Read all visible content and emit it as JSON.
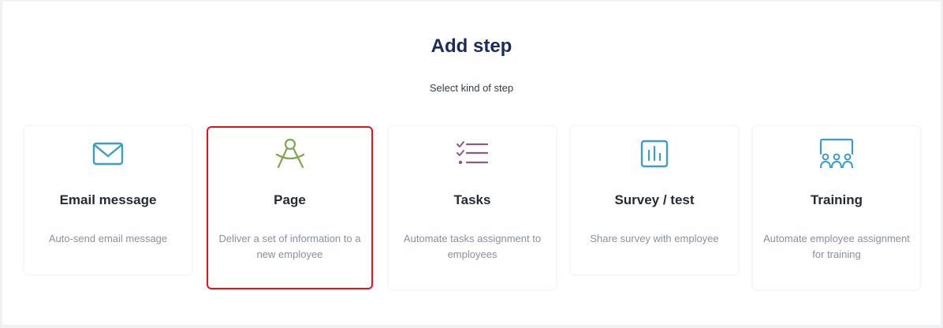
{
  "dialog": {
    "title": "Add step",
    "subtitle": "Select kind of step"
  },
  "cards": [
    {
      "name": "Email message",
      "description": "Auto-send email message",
      "icon": "envelope-icon",
      "icon_color": "#3a9ec3"
    },
    {
      "name": "Page",
      "description": "Deliver a set of information to a new employee",
      "icon": "compass-icon",
      "icon_color": "#7ea64a",
      "selected": true
    },
    {
      "name": "Tasks",
      "description": "Automate tasks assignment to employees",
      "icon": "checklist-icon",
      "icon_color": "#8c5a82"
    },
    {
      "name": "Survey / test",
      "description": "Share survey with employee",
      "icon": "bar-chart-icon",
      "icon_color": "#3a9ec3"
    },
    {
      "name": "Training",
      "description": "Automate employee assignment for training",
      "icon": "group-training-icon",
      "icon_color": "#3a9ec3"
    }
  ],
  "colors": {
    "title": "#1c2a5c",
    "selected_border": "#e0141b"
  }
}
